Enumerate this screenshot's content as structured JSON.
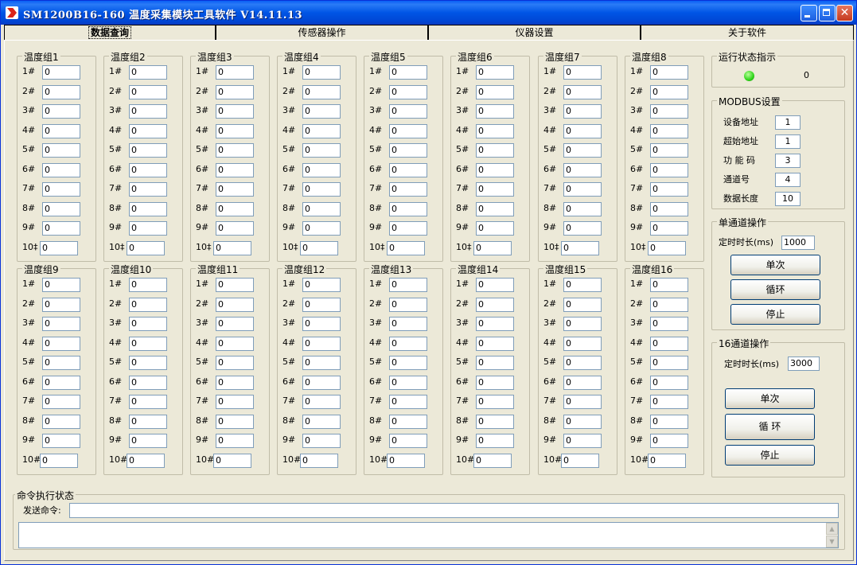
{
  "window": {
    "title": "SM1200B16-160 温度采集模块工具软件 V14.11.13"
  },
  "tabs": [
    {
      "label": "数据查询"
    },
    {
      "label": "传感器操作"
    },
    {
      "label": "仪器设置"
    },
    {
      "label": "关于软件"
    }
  ],
  "groups": [
    {
      "title": "温度组1"
    },
    {
      "title": "温度组2"
    },
    {
      "title": "温度组3"
    },
    {
      "title": "温度组4"
    },
    {
      "title": "温度组5"
    },
    {
      "title": "温度组6"
    },
    {
      "title": "温度组7"
    },
    {
      "title": "温度组8"
    },
    {
      "title": "温度组9"
    },
    {
      "title": "温度组10"
    },
    {
      "title": "温度组11"
    },
    {
      "title": "温度组12"
    },
    {
      "title": "温度组13"
    },
    {
      "title": "温度组14"
    },
    {
      "title": "温度组15"
    },
    {
      "title": "温度组16"
    }
  ],
  "channel_labels_top": [
    "1#",
    "2#",
    "3#",
    "4#",
    "5#",
    "6#",
    "7#",
    "8#",
    "9#",
    "10‡"
  ],
  "channel_labels_bottom": [
    "1#",
    "2#",
    "3#",
    "4#",
    "5#",
    "6#",
    "7#",
    "8#",
    "9#",
    "10#"
  ],
  "channel_value": "0",
  "status": {
    "title": "运行状态指示",
    "led_color": "#2FD41A",
    "count": "0"
  },
  "modbus": {
    "title": "MODBUS设置",
    "fields": [
      {
        "label": "设备地址",
        "value": "1"
      },
      {
        "label": "超始地址",
        "value": "1"
      },
      {
        "label": "功 能 码",
        "value": "3"
      },
      {
        "label": "通道号",
        "value": "4"
      },
      {
        "label": "数据长度",
        "value": "10"
      }
    ]
  },
  "single_channel": {
    "title": "单通道操作",
    "timer_label": "定时时长(ms)",
    "timer_value": "1000",
    "buttons": [
      "单次",
      "循环",
      "停止"
    ]
  },
  "sixteen_channel": {
    "title": "16通道操作",
    "timer_label": "定时时长(ms)",
    "timer_value": "3000",
    "buttons": [
      "单次",
      "循 环",
      "停止"
    ]
  },
  "command": {
    "title": "命令执行状态",
    "send_label": "发送命令:",
    "send_value": "",
    "log_value": ""
  }
}
